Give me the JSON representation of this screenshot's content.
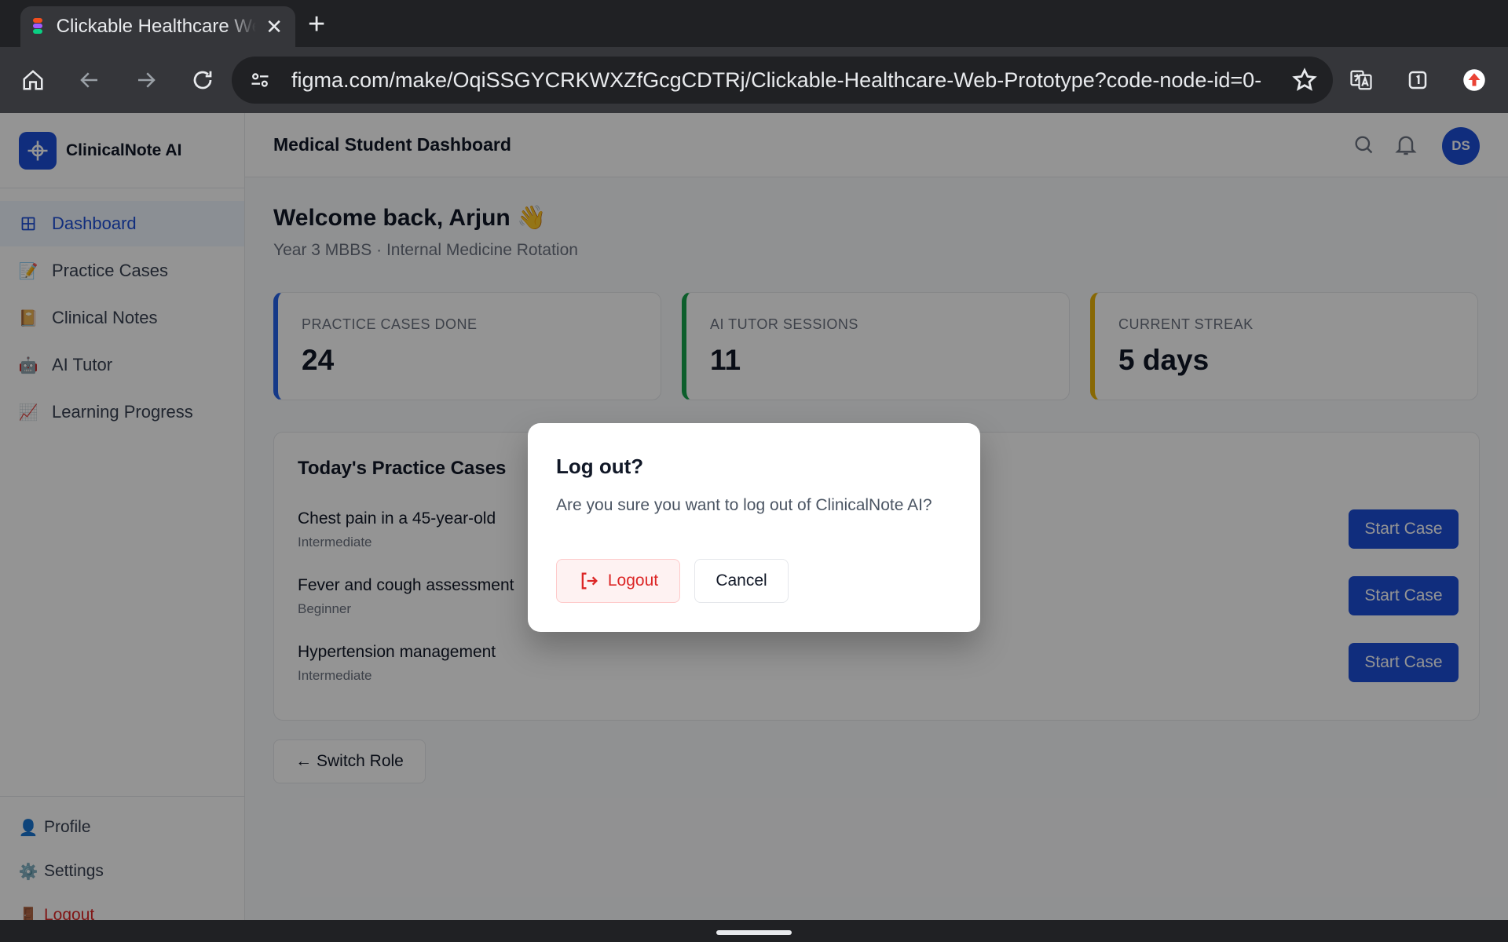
{
  "browser": {
    "tab_title": "Clickable Healthcare Web Prototype",
    "url": "figma.com/make/OqiSSGYCRKWXZfGcgCDTRj/Clickable-Healthcare-Web-Prototype?code-node-id=0-"
  },
  "sidebar": {
    "brand": "ClinicalNote AI",
    "items": [
      {
        "label": "Dashboard",
        "icon": "grid-icon",
        "active": true
      },
      {
        "label": "Practice Cases",
        "icon": "memo-icon"
      },
      {
        "label": "Clinical Notes",
        "icon": "notebook-icon"
      },
      {
        "label": "AI Tutor",
        "icon": "robot-icon"
      },
      {
        "label": "Learning Progress",
        "icon": "chart-increasing-icon"
      }
    ],
    "bottom": [
      {
        "label": "Profile",
        "icon": "person-icon"
      },
      {
        "label": "Settings",
        "icon": "gear-icon"
      },
      {
        "label": "Logout",
        "icon": "door-icon"
      }
    ]
  },
  "topbar": {
    "title": "Medical Student Dashboard",
    "avatar_initials": "DS"
  },
  "main": {
    "welcome": "Welcome back, Arjun 👋",
    "subtitle": "Year 3 MBBS · Internal Medicine Rotation",
    "stats": [
      {
        "label": "PRACTICE CASES DONE",
        "value": "24",
        "accent": "#2563eb"
      },
      {
        "label": "AI TUTOR SESSIONS",
        "value": "11",
        "accent": "#16a34a"
      },
      {
        "label": "CURRENT STREAK",
        "value": "5 days",
        "accent": "#eab308"
      }
    ],
    "cases_title": "Today's Practice Cases",
    "cases": [
      {
        "name": "Chest pain in a 45-year-old",
        "level": "Intermediate",
        "button": "Start Case"
      },
      {
        "name": "Fever and cough assessment",
        "level": "Beginner",
        "button": "Start Case"
      },
      {
        "name": "Hypertension management",
        "level": "Intermediate",
        "button": "Start Case"
      }
    ],
    "switch_role": "← Switch Role"
  },
  "modal": {
    "title": "Log out?",
    "text": "Are you sure you want to log out of ClinicalNote AI?",
    "logout_label": "Logout",
    "cancel_label": "Cancel"
  },
  "colors": {
    "primary": "#1d4ed8",
    "danger": "#dc2626"
  }
}
